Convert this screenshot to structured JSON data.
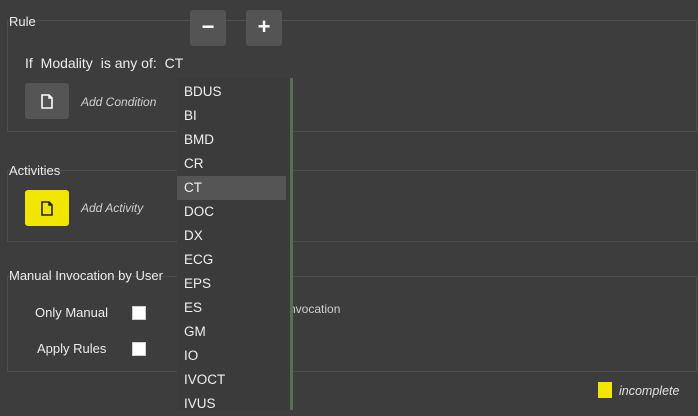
{
  "rule": {
    "title": "Rule",
    "minus_label": "−",
    "plus_label": "+",
    "condition": {
      "if": "If",
      "field": "Modality",
      "operator": "is any of:",
      "value": "CT"
    },
    "add_condition_label": "Add Condition"
  },
  "activities": {
    "title": "Activities",
    "add_activity_label": "Add Activity"
  },
  "manual": {
    "title": "Manual Invocation by User",
    "only_manual_label": "Only Manual",
    "apply_rules_label": "Apply Rules",
    "partial_text": "nvocation"
  },
  "status": {
    "label": "incomplete",
    "color": "#f2e600"
  },
  "dropdown": {
    "options": [
      "BDUS",
      "BI",
      "BMD",
      "CR",
      "CT",
      "DOC",
      "DX",
      "ECG",
      "EPS",
      "ES",
      "GM",
      "IO",
      "IVOCT",
      "IVUS"
    ],
    "selected": "CT"
  }
}
